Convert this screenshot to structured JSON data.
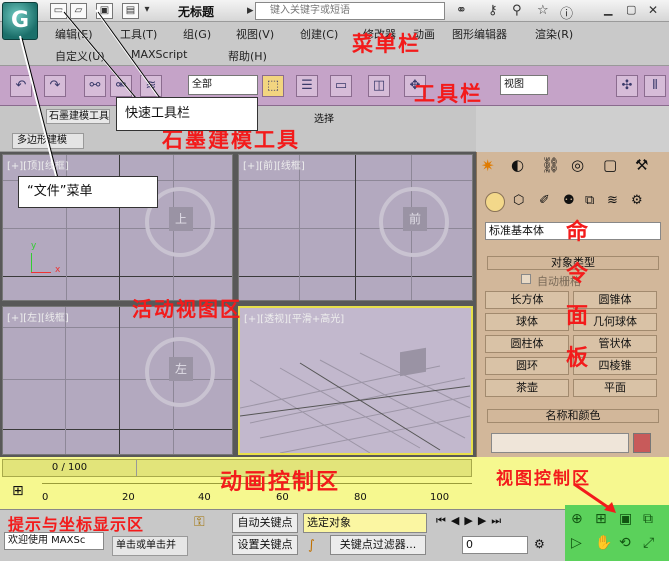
{
  "titlebar": {
    "title": "无标题",
    "search_placeholder": "键入关键字或短语",
    "app_icon": "G"
  },
  "menu": {
    "row1": [
      "编辑(E)",
      "工具(T)",
      "组(G)",
      "视图(V)",
      "创建(C)",
      "修改器",
      "动画",
      "图形编辑器",
      "渲染(R)"
    ],
    "row2": [
      "自定义(U)",
      "MAXScript",
      "帮助(H)"
    ]
  },
  "toolbar": {
    "select_filter": "全部",
    "named_selection": "视图"
  },
  "ribbon": {
    "tab1": "石墨建模工具",
    "tab2": "选择",
    "tab3": "多边形建模"
  },
  "viewports": {
    "top": "[+][顶][线框]",
    "front": "[+][前][线框]",
    "left": "[+][左][线框]",
    "persp": "[+][透视][平滑+高光]",
    "top_cube": "上",
    "front_cube": "前",
    "left_cube": "左"
  },
  "command_panel": {
    "dropdown": "标准基本体",
    "object_type_header": "对象类型",
    "autogrid": "自动栅格",
    "buttons": [
      "长方体",
      "圆锥体",
      "球体",
      "几何球体",
      "圆柱体",
      "管状体",
      "圆环",
      "四棱锥",
      "茶壶",
      "平面"
    ],
    "name_color_header": "名称和颜色",
    "swatch_color": "#c85a5a"
  },
  "timeline": {
    "frame": "0 / 100",
    "ticks": [
      "0",
      "20",
      "40",
      "60",
      "80",
      "100"
    ]
  },
  "status": {
    "welcome": "欢迎使用 MAXSc",
    "hint": "单击或单击并",
    "autokey": "自动关键点",
    "set_key": "设置关键点",
    "selected": "选定对象",
    "key_filters": "关键点过滤器...",
    "frame_field": "0"
  },
  "annotations": {
    "menubar": "菜单栏",
    "toolbar": "工具栏",
    "graphite": "石墨建模工具",
    "viewport": "活动视图区",
    "command": [
      "命",
      "令",
      "面",
      "板"
    ],
    "animation": "动画控制区",
    "viewcontrol": "视图控制区",
    "prompt": "提示与坐标显示区",
    "file_menu": "“文件”菜单",
    "quick_access": "快速工具栏"
  }
}
